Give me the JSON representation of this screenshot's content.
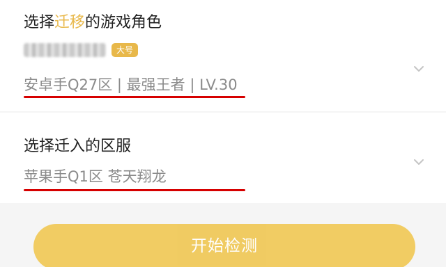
{
  "section_migrate": {
    "label_prefix": "选择",
    "label_accent": "迁移",
    "label_suffix": "的游戏角色",
    "badge": "大号",
    "value": "安卓手Q27区 | 最强王者 | LV.30"
  },
  "section_target": {
    "label": "选择迁入的区服",
    "value": "苹果手Q1区 苍天翔龙"
  },
  "start_button": "开始检测",
  "colors": {
    "accent": "#e8b84a",
    "button": "#f0c95b",
    "underline": "#d60000"
  },
  "icons": {
    "dropdown": "chevron-down-icon"
  }
}
